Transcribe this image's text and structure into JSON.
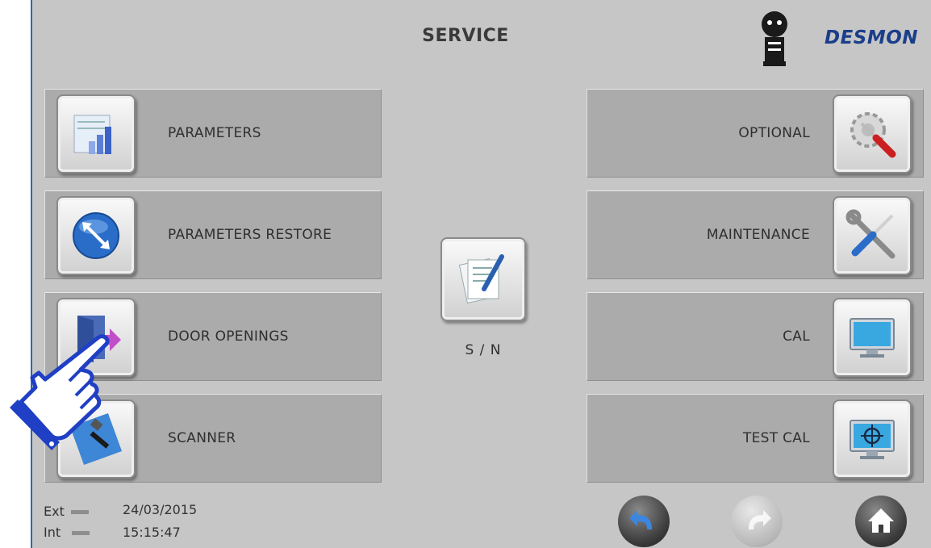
{
  "header": {
    "title": "SERVICE",
    "logo_text": "DESMON"
  },
  "left_tiles": [
    {
      "label": "PARAMETERS",
      "icon": "parameters-chart-icon"
    },
    {
      "label": "PARAMETERS RESTORE",
      "icon": "restore-arrow-icon"
    },
    {
      "label": "DOOR OPENINGS",
      "icon": "door-icon"
    },
    {
      "label": "SCANNER",
      "icon": "scanner-tools-icon"
    }
  ],
  "right_tiles": [
    {
      "label": "OPTIONAL",
      "icon": "screwdriver-gear-icon"
    },
    {
      "label": "MAINTENANCE",
      "icon": "wrench-screwdriver-icon"
    },
    {
      "label": "CAL",
      "icon": "monitor-icon"
    },
    {
      "label": "TEST CAL",
      "icon": "monitor-crosshair-icon"
    }
  ],
  "center": {
    "label": "S / N",
    "icon": "document-pencil-icon"
  },
  "status": {
    "ext_label": "Ext",
    "int_label": "Int",
    "date": "24/03/2015",
    "time": "15:15:47"
  },
  "nav": {
    "back_icon": "back-arrow-icon",
    "forward_icon": "forward-arrow-icon",
    "home_icon": "home-icon"
  },
  "colors": {
    "background": "#c6c6c6",
    "tile": "#ababab",
    "accent_blue": "#2f63b4",
    "logo_blue": "#1a3e8a"
  }
}
